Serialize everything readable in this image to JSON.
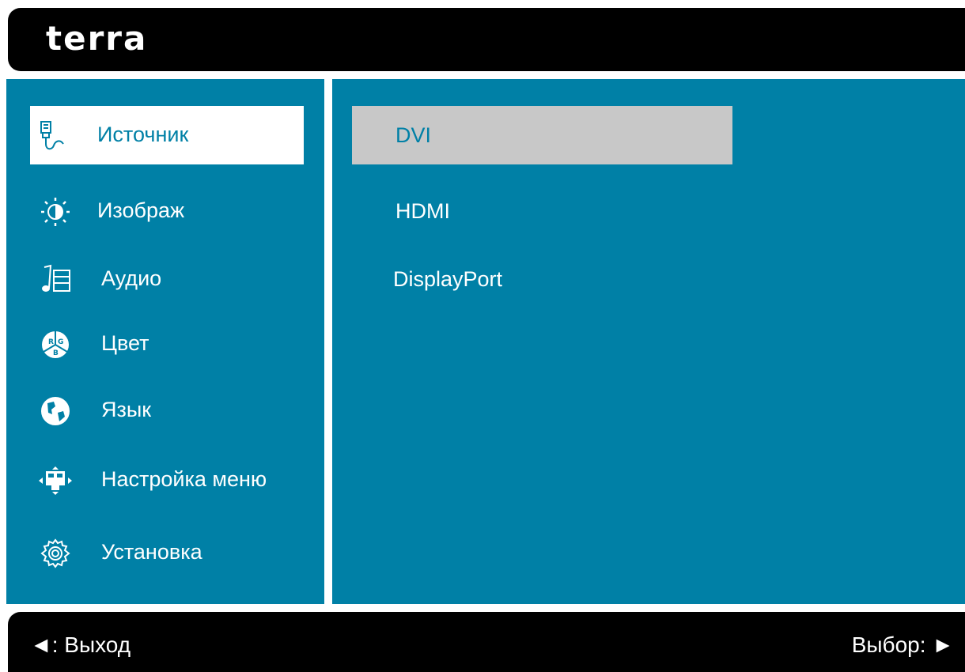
{
  "header": {
    "logo": "terra"
  },
  "menu": {
    "items": [
      {
        "label": "Источник",
        "icon": "input-source-icon",
        "selected": true
      },
      {
        "label": "Изображ",
        "icon": "brightness-icon"
      },
      {
        "label": "Аудио",
        "icon": "audio-note-icon"
      },
      {
        "label": "Цвет",
        "icon": "rgb-color-icon"
      },
      {
        "label": "Язык",
        "icon": "globe-icon"
      },
      {
        "label": "Настройка меню",
        "icon": "osd-position-icon"
      },
      {
        "label": "Установка",
        "icon": "gear-icon"
      }
    ]
  },
  "sources": {
    "items": [
      {
        "label": "DVI",
        "selected": true
      },
      {
        "label": "HDMI"
      },
      {
        "label": "DisplayPort"
      }
    ]
  },
  "footer": {
    "exit": "◄: Выход",
    "select": "Выбор: ►"
  },
  "colors": {
    "panel": "#0080a6",
    "selected_menu_bg": "#ffffff",
    "selected_source_bg": "#c8c8c8",
    "bar": "#000000"
  }
}
